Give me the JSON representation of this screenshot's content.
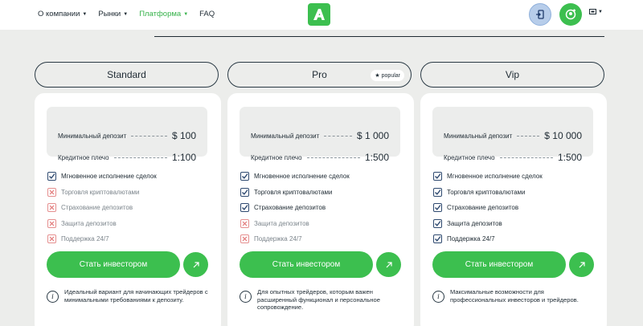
{
  "nav": {
    "items": [
      {
        "label": "О компании",
        "caret": true,
        "active": false
      },
      {
        "label": "Рынки",
        "caret": true,
        "active": false
      },
      {
        "label": "Платформа",
        "caret": true,
        "active": true
      },
      {
        "label": "FAQ",
        "caret": false,
        "active": false
      }
    ]
  },
  "header": {
    "logo_letter": "A",
    "login_icon": "login-door-icon",
    "register_icon": "user-plus-icon",
    "language_icon": "flag-icon"
  },
  "colors": {
    "accent": "#3cbf4f",
    "text": "#1e2a33",
    "background": "#ecedeb"
  },
  "plans": [
    {
      "name": "Standard",
      "badge": "",
      "min_deposit_label": "Минимальный депозит",
      "min_deposit": "$ 100",
      "leverage_label": "Кредитное плечо",
      "leverage": "1:100",
      "features": [
        {
          "label": "Мгновенное исполнение сделок",
          "enabled": true
        },
        {
          "label": "Торговля криптовалютами",
          "enabled": false
        },
        {
          "label": "Страхование депозитов",
          "enabled": false
        },
        {
          "label": "Защита депозитов",
          "enabled": false
        },
        {
          "label": "Поддержка 24/7",
          "enabled": false
        }
      ],
      "cta_label": "Стать инвестором",
      "note": "Идеальный вариант для начинающих трейдеров с минимальными требованиями к депозиту."
    },
    {
      "name": "Pro",
      "badge": "popular",
      "min_deposit_label": "Минимальный депозит",
      "min_deposit": "$ 1 000",
      "leverage_label": "Кредитное плечо",
      "leverage": "1:500",
      "features": [
        {
          "label": "Мгновенное исполнение сделок",
          "enabled": true
        },
        {
          "label": "Торговля криптовалютами",
          "enabled": true
        },
        {
          "label": "Страхование депозитов",
          "enabled": true
        },
        {
          "label": "Защита депозитов",
          "enabled": false
        },
        {
          "label": "Поддержка 24/7",
          "enabled": false
        }
      ],
      "cta_label": "Стать инвестором",
      "note": "Для опытных трейдеров, которым важен расширенный функционал и персональное сопровождение."
    },
    {
      "name": "Vip",
      "badge": "",
      "min_deposit_label": "Минимальный депозит",
      "min_deposit": "$ 10 000",
      "leverage_label": "Кредитное плечо",
      "leverage": "1:500",
      "features": [
        {
          "label": "Мгновенное исполнение сделок",
          "enabled": true
        },
        {
          "label": "Торговля криптовалютами",
          "enabled": true
        },
        {
          "label": "Страхование депозитов",
          "enabled": true
        },
        {
          "label": "Защита депозитов",
          "enabled": true
        },
        {
          "label": "Поддержка 24/7",
          "enabled": true
        }
      ],
      "cta_label": "Стать инвестором",
      "note": "Максимальные возможности для профессиональных инвесторов и трейдеров."
    }
  ]
}
